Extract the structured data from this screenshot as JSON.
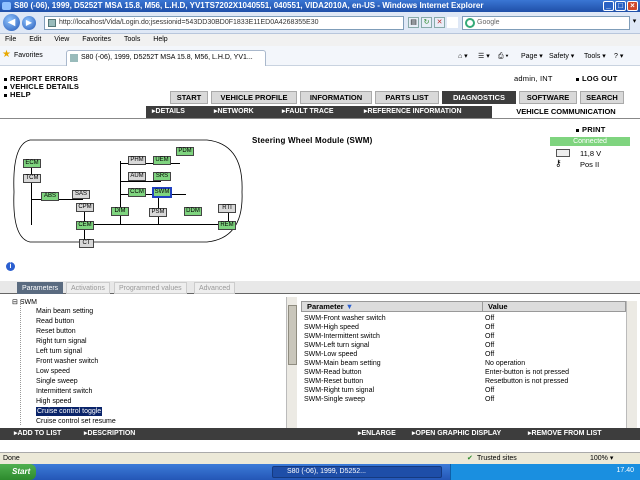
{
  "window": {
    "title": "S80 (-06), 1999, D5252T MSA 15.8, M56, L.H.D, YV1TS7202X1040551, 040551, VIDA2010A, en-US - Windows Internet Explorer"
  },
  "browser": {
    "address": "http://localhost/Vida/Login.do;jsessionid=543DD30BD0F1833E11ED0A4268355E30",
    "search_placeholder": "Google",
    "menu": [
      "File",
      "Edit",
      "View",
      "Favorites",
      "Tools",
      "Help"
    ],
    "favorites_label": "Favorites",
    "tab_title": "S80 (-06), 1999, D5252T MSA 15.8, M56, L.H.D, YV1...",
    "tools": {
      "page": "Page",
      "safety": "Safety",
      "tools": "Tools"
    }
  },
  "header": {
    "left_links": [
      "REPORT ERRORS",
      "VEHICLE DETAILS",
      "HELP"
    ],
    "user": "admin, INT",
    "logout": "LOG OUT"
  },
  "main_tabs": [
    "START",
    "VEHICLE PROFILE",
    "INFORMATION",
    "PARTS LIST",
    "DIAGNOSTICS",
    "SOFTWARE",
    "SEARCH"
  ],
  "active_tab": "DIAGNOSTICS",
  "sub_nav": [
    "DETAILS",
    "NETWORK",
    "FAULT TRACE",
    "REFERENCE INFORMATION"
  ],
  "vehicle_communication": "VEHICLE COMMUNICATION",
  "module_title": "Steering Wheel Module (SWM)",
  "print_label": "PRINT",
  "connection": {
    "status": "Connected",
    "voltage": "11,8 V",
    "ignition": "Pos II",
    "accent": "#7fd47f"
  },
  "diagram_nodes": [
    "ECM",
    "TCM",
    "ABS",
    "SAS",
    "CPM",
    "CEM",
    "CT",
    "PHM",
    "UEM",
    "PDM",
    "AUM",
    "SRS",
    "CCM",
    "SWM",
    "DIM",
    "PSM",
    "DDM",
    "RTI",
    "REM"
  ],
  "diagram_active_nodes": [
    "ECM",
    "ABS",
    "CEM",
    "UEM",
    "PDM",
    "SRS",
    "CCM",
    "SWM",
    "DIM",
    "DDM",
    "REM"
  ],
  "panel_tabs": [
    "Parameters",
    "Activations",
    "Programmed values",
    "Advanced"
  ],
  "active_panel_tab": "Parameters",
  "tree": {
    "root": "SWM",
    "items": [
      "Main beam setting",
      "Read button",
      "Reset button",
      "Right turn signal",
      "Left turn signal",
      "Front washer switch",
      "Low speed",
      "Single sweep",
      "Intermittent switch",
      "High speed",
      "Cruise control toggle",
      "Cruise control set resume"
    ],
    "selected": "Cruise control toggle"
  },
  "grid": {
    "headers": [
      "Parameter",
      "Value"
    ],
    "rows": [
      {
        "param": "SWM-Front washer switch",
        "value": "Off"
      },
      {
        "param": "SWM-High speed",
        "value": "Off"
      },
      {
        "param": "SWM-Intermittent switch",
        "value": "Off"
      },
      {
        "param": "SWM-Left turn signal",
        "value": "Off"
      },
      {
        "param": "SWM-Low speed",
        "value": "Off"
      },
      {
        "param": "SWM-Main beam setting",
        "value": "No operation"
      },
      {
        "param": "SWM-Read button",
        "value": "Enter-button is not pressed"
      },
      {
        "param": "SWM-Reset button",
        "value": "Resetbutton is not pressed"
      },
      {
        "param": "SWM-Right turn signal",
        "value": "Off"
      },
      {
        "param": "SWM-Single sweep",
        "value": "Off"
      }
    ]
  },
  "bottom_actions": {
    "add_to_list": "ADD TO LIST",
    "description": "DESCRIPTION",
    "enlarge": "ENLARGE",
    "open_graphic": "OPEN GRAPHIC DISPLAY",
    "remove": "REMOVE FROM LIST"
  },
  "status": {
    "left": "Done",
    "zone": "Trusted sites",
    "zoom": "100%"
  },
  "taskbar": {
    "start": "Start",
    "task": "S80 (-06), 1999, D5252...",
    "clock": "17.40"
  }
}
